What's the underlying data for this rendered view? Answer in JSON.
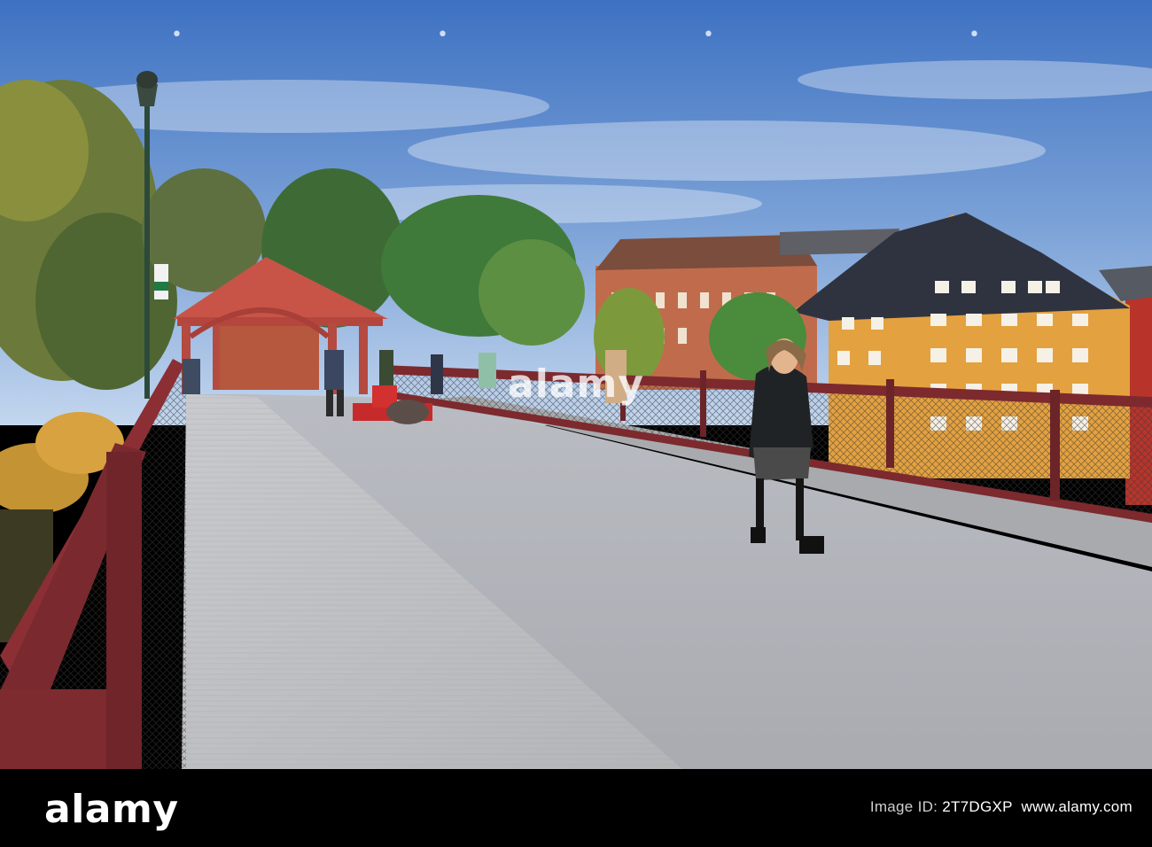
{
  "watermark": {
    "center_text": "alamy",
    "marker_glyph": "•"
  },
  "footer": {
    "logo_text": "alamy",
    "caption_prefix": "Image ID: ",
    "image_id": "2T7DGXP",
    "caption_separator": "  ",
    "url_text": "www.alamy.com"
  },
  "colors": {
    "sky_top": "#3f74c4",
    "sky_bottom": "#bcd2ec",
    "portal_red": "#c6534a",
    "yellow_building": "#e6a23e",
    "deck_gray": "#bfc0c3",
    "railing": "#7f2b2f",
    "footer_bg": "#000000"
  }
}
